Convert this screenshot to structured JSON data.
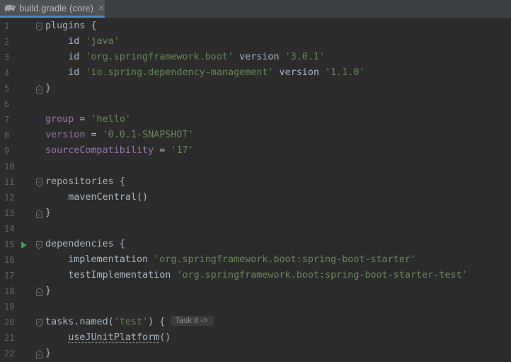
{
  "tab": {
    "title": "build.gradle (core)",
    "close": "×",
    "icon": "gradle-elephant-icon"
  },
  "inlay_hint": "Task it ->",
  "colors": {
    "background": "#2b2b2b",
    "text": "#a9b7c6",
    "string": "#6a8759",
    "line_number": "#606366",
    "run_icon": "#499c54",
    "tab_underline": "#4a88c7"
  },
  "lines": [
    {
      "n": "1",
      "t1": "plugins {"
    },
    {
      "n": "2",
      "t1": "    id ",
      "s1": "'java'"
    },
    {
      "n": "3",
      "t1": "    id ",
      "s1": "'org.springframework.boot'",
      "t2": " version ",
      "s2": "'3.0.1'"
    },
    {
      "n": "4",
      "t1": "    id ",
      "s1": "'io.spring.dependency-management'",
      "t2": " version ",
      "s2": "'1.1.0'"
    },
    {
      "n": "5",
      "t1": "}"
    },
    {
      "n": "6"
    },
    {
      "n": "7",
      "p1": "group",
      "t1": " = ",
      "s1": "'hello'"
    },
    {
      "n": "8",
      "p1": "version",
      "t1": " = ",
      "s1": "'0.0.1-SNAPSHOT'"
    },
    {
      "n": "9",
      "p1": "sourceCompatibility",
      "t1": " = ",
      "s1": "'17'"
    },
    {
      "n": "10"
    },
    {
      "n": "11",
      "t1": "repositories {"
    },
    {
      "n": "12",
      "t1": "    mavenCentral()"
    },
    {
      "n": "13",
      "t1": "}"
    },
    {
      "n": "14"
    },
    {
      "n": "15",
      "t1": "dependencies {"
    },
    {
      "n": "16",
      "t1": "    implementation ",
      "s1": "'org.springframework.boot:spring-boot-starter'"
    },
    {
      "n": "17",
      "t1": "    testImplementation ",
      "s1": "'org.springframework.boot:spring-boot-starter-test'"
    },
    {
      "n": "18",
      "t1": "}"
    },
    {
      "n": "19"
    },
    {
      "n": "20",
      "t1": "tasks.named(",
      "s1": "'test'",
      "t2": ") {"
    },
    {
      "n": "21",
      "t1": "    ",
      "u1": "useJUnitPlatform",
      "t2": "()"
    },
    {
      "n": "22",
      "t1": "}"
    }
  ]
}
